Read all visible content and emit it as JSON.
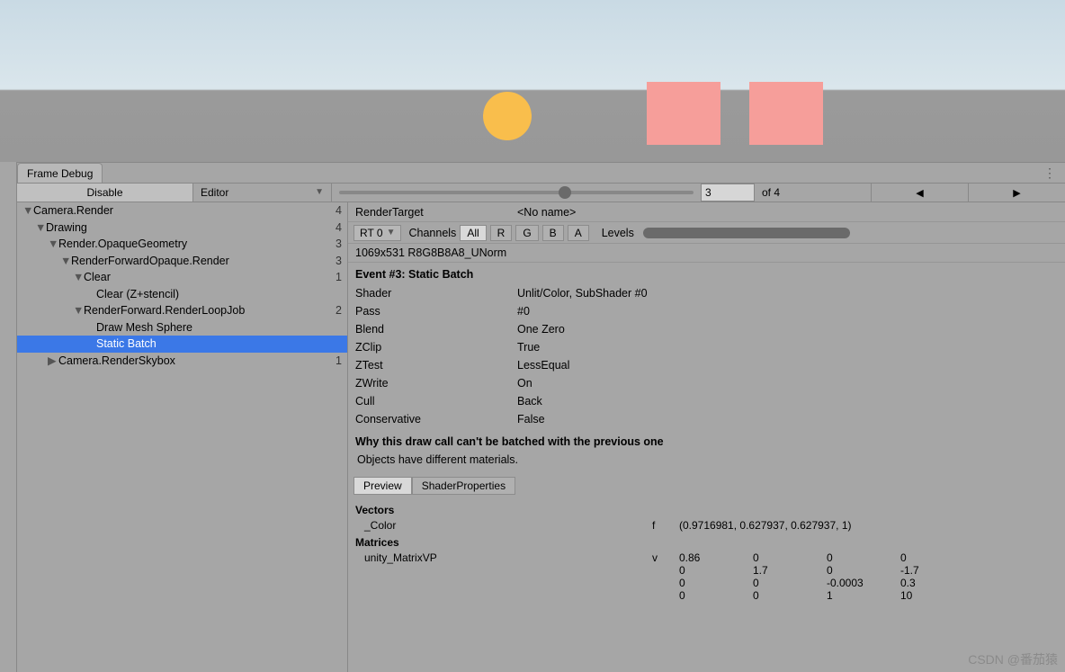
{
  "tab": {
    "title": "Frame Debug"
  },
  "toolbar": {
    "disable": "Disable",
    "editor": "Editor",
    "step_value": "3",
    "of_text": "of 4",
    "prev": "◀",
    "next": "▶"
  },
  "tree": [
    {
      "label": "Camera.Render",
      "indent": 0,
      "arrow": "▼",
      "count": "4"
    },
    {
      "label": "Drawing",
      "indent": 1,
      "arrow": "▼",
      "count": "4"
    },
    {
      "label": "Render.OpaqueGeometry",
      "indent": 2,
      "arrow": "▼",
      "count": "3"
    },
    {
      "label": "RenderForwardOpaque.Render",
      "indent": 3,
      "arrow": "▼",
      "count": "3"
    },
    {
      "label": "Clear",
      "indent": 4,
      "arrow": "▼",
      "count": "1"
    },
    {
      "label": "Clear (Z+stencil)",
      "indent": 5,
      "arrow": "",
      "count": ""
    },
    {
      "label": "RenderForward.RenderLoopJob",
      "indent": 4,
      "arrow": "▼",
      "count": "2"
    },
    {
      "label": "Draw Mesh Sphere",
      "indent": 5,
      "arrow": "",
      "count": ""
    },
    {
      "label": "Static Batch",
      "indent": 5,
      "arrow": "",
      "count": "",
      "selected": true
    },
    {
      "label": "Camera.RenderSkybox",
      "indent": 2,
      "arrow": "▶",
      "count": "1"
    }
  ],
  "render_target": {
    "label": "RenderTarget",
    "value": "<No name>",
    "rt_dropdown": "RT 0",
    "channels_label": "Channels",
    "channels": [
      "All",
      "R",
      "G",
      "B",
      "A"
    ],
    "levels_label": "Levels",
    "dims": "1069x531 R8G8B8A8_UNorm"
  },
  "event": {
    "title": "Event #3: Static Batch",
    "rows": [
      {
        "k": "Shader",
        "v": "Unlit/Color, SubShader #0"
      },
      {
        "k": "Pass",
        "v": "#0"
      },
      {
        "k": "Blend",
        "v": "One Zero"
      },
      {
        "k": "ZClip",
        "v": "True"
      },
      {
        "k": "ZTest",
        "v": "LessEqual"
      },
      {
        "k": "ZWrite",
        "v": "On"
      },
      {
        "k": "Cull",
        "v": "Back"
      },
      {
        "k": "Conservative",
        "v": "False"
      }
    ]
  },
  "batch": {
    "heading": "Why this draw call can't be batched with the previous one",
    "reason": "Objects have different materials."
  },
  "subtabs": {
    "preview": "Preview",
    "props": "ShaderProperties"
  },
  "vectors": {
    "heading": "Vectors",
    "name": "_Color",
    "type": "f",
    "value": "(0.9716981, 0.627937, 0.627937, 1)"
  },
  "matrices": {
    "heading": "Matrices",
    "name": "unity_MatrixVP",
    "type": "v",
    "rows": [
      [
        "0.86",
        "0",
        "0",
        "0"
      ],
      [
        "0",
        "1.7",
        "0",
        "-1.7"
      ],
      [
        "0",
        "0",
        "-0.0003",
        "0.3"
      ],
      [
        "0",
        "0",
        "1",
        "10"
      ]
    ]
  },
  "watermark": "CSDN @番茄猿"
}
